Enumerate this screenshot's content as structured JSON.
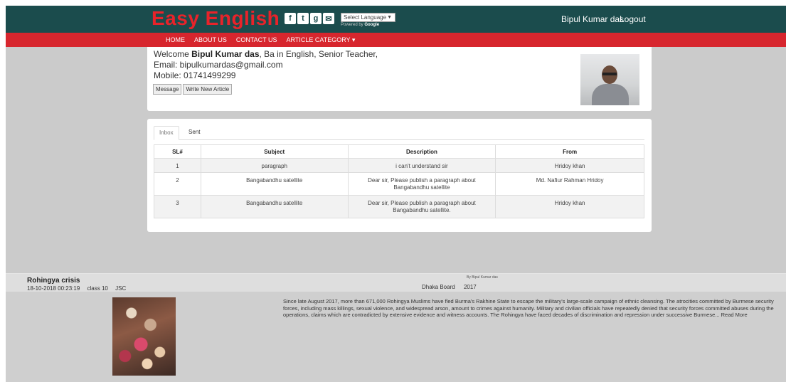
{
  "header": {
    "logo": "Easy English",
    "social_icons": [
      "facebook-icon",
      "twitter-icon",
      "google-plus-icon",
      "email-icon"
    ],
    "language_select": "Select Language",
    "language_powered": "Powered by",
    "language_brand": "Google",
    "user_name": "Bipul Kumar das",
    "logout_label": "Logout"
  },
  "nav": {
    "items": [
      "HOME",
      "ABOUT US",
      "CONTACT US",
      "ARTICLE CATEGORY ▾"
    ]
  },
  "profile": {
    "welcome_prefix": "Welcome",
    "name": "Bipul Kumar das",
    "title_suffix": ", Ba in English, Senior Teacher,",
    "email": "Email: bipulkumardas@gmail.com",
    "mobile": "Mobile: 01741499299",
    "message_button": "Message",
    "write_button": "Write New Article"
  },
  "inbox": {
    "tabs": [
      "Inbox",
      "Sent"
    ],
    "columns": [
      "SL#",
      "Subject",
      "Description",
      "From"
    ],
    "rows": [
      {
        "sl": "1",
        "subject": "paragraph",
        "description": "i can't understand sir",
        "from": "Hridoy khan"
      },
      {
        "sl": "2",
        "subject": "Bangabandhu satellite",
        "description": "Dear sir, Please publish a paragraph about Bangabandhu satellite",
        "from": "Md. Nafiur Rahman Hridoy"
      },
      {
        "sl": "3",
        "subject": "Bangabandhu satellite",
        "description": "Dear sir, Please publish a paragraph about Bangabandhu satellite.",
        "from": "Hridoy khan"
      }
    ]
  },
  "article": {
    "title": "Rohingya crisis",
    "datetime": "18-10-2018 00:23:19",
    "class": "class 10",
    "exam": "JSC",
    "by": "By Bipul Kumar das",
    "board": "Dhaka Board",
    "year": "2017",
    "text": "Since late August 2017, more than 671,000 Rohingya Muslims have fled Burma's Rakhine State to escape the military's large-scale campaign of ethnic cleansing. The atrocities committed by Burmese security forces, including mass killings, sexual violence, and widespread arson, amount to crimes against humanity. Military and civilian officials have repeatedly denied that security forces committed abuses during the operations, claims which are contradicted by extensive evidence and witness accounts. The Rohingya have faced decades of discrimination and repression under successive Burmese... Read More"
  }
}
